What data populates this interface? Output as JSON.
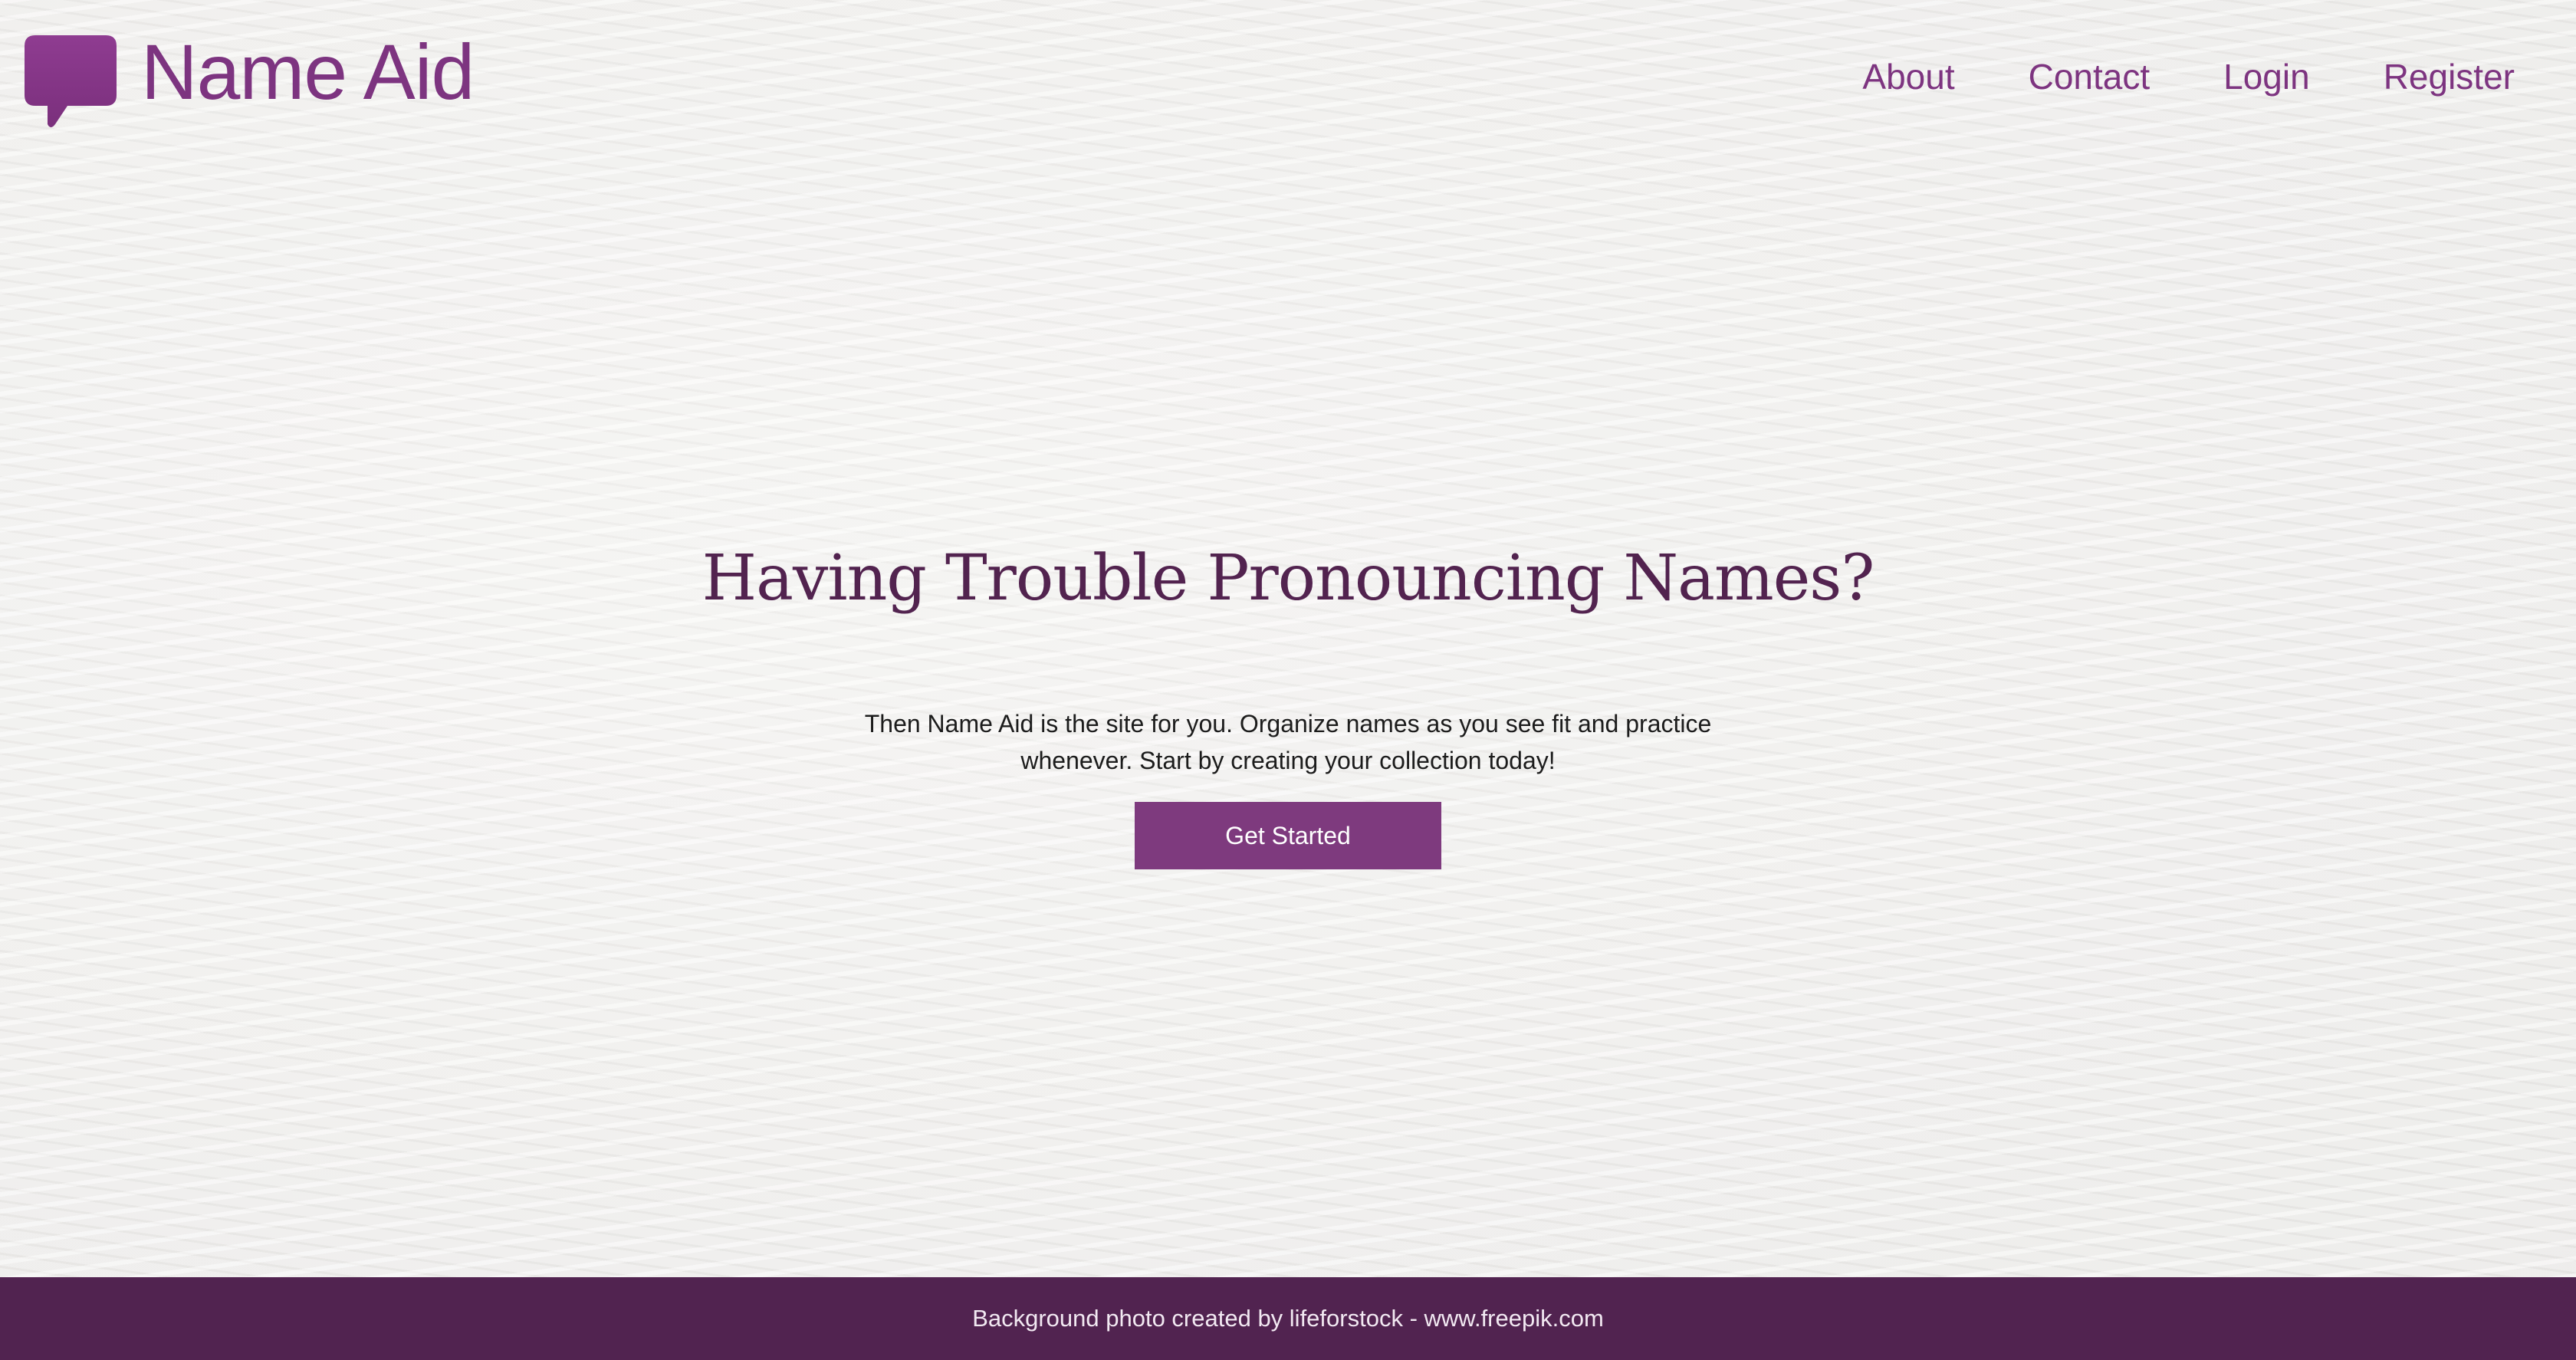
{
  "brand": {
    "name": "Name Aid",
    "icon": "speech-bubble-icon",
    "color": "#7d3480"
  },
  "nav": {
    "items": [
      {
        "label": "About"
      },
      {
        "label": "Contact"
      },
      {
        "label": "Login"
      },
      {
        "label": "Register"
      }
    ]
  },
  "hero": {
    "title": "Having Trouble Pronouncing Names?",
    "text": "Then Name Aid is the site for you. Organize names as you see fit and practice whenever. Start by creating your collection today!",
    "cta_label": "Get Started",
    "cta_color": "#7e3a7e",
    "title_color": "#52234f"
  },
  "footer": {
    "text": "Background photo created by lifeforstock - www.freepik.com",
    "background": "#512350"
  }
}
